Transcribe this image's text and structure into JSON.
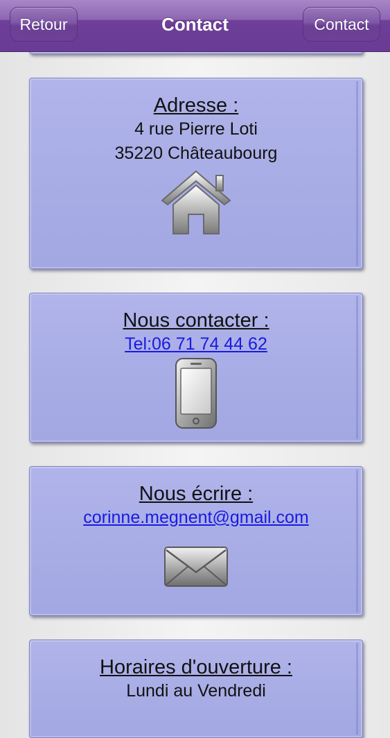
{
  "navbar": {
    "back_label": "Retour",
    "title": "Contact",
    "contact_label": "Contact"
  },
  "address": {
    "heading": "Adresse :",
    "street": "4 rue Pierre Loti",
    "city": "35220 Châteaubourg",
    "icon": "home-icon"
  },
  "phone": {
    "heading": "Nous contacter :",
    "link": "Tel:06 71 74 44 62",
    "icon": "smartphone-icon"
  },
  "email": {
    "heading": "Nous écrire :",
    "link": "corinne.megnent@gmail.com",
    "icon": "envelope-icon"
  },
  "hours": {
    "heading": "Horaires d'ouverture :",
    "days": "Lundi au Vendredi"
  },
  "colors": {
    "navbar": "#6a3b94",
    "card": "#a8ace6",
    "link": "#1a1ae0"
  }
}
